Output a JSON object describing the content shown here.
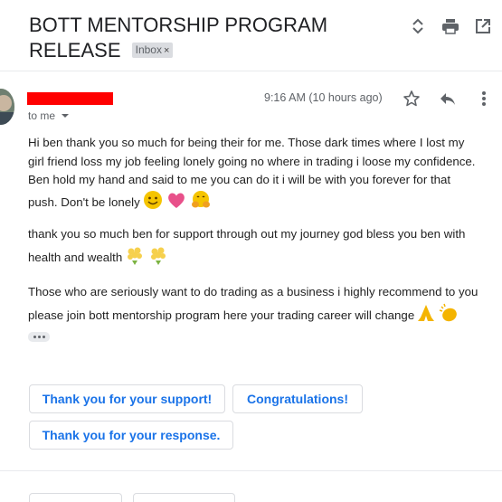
{
  "subject": {
    "line1": "BOTT MENTORSHIP PROGRAM",
    "line2": "RELEASE",
    "label": "Inbox",
    "label_close": "×"
  },
  "toolbar": {
    "icons": [
      "expand-collapse-icon",
      "print-icon",
      "open-in-new-window-icon"
    ]
  },
  "message": {
    "sender_name": "",
    "to": "to me",
    "time": "9:16 AM (10 hours ago)",
    "actions": [
      "star-icon",
      "reply-icon",
      "more-vert-icon"
    ],
    "paragraphs": [
      "Hi ben thank you so much for being their for me. Those dark times where I lost my girl friend loss my job feeling lonely going no where in trading i loose my confidence. Ben hold my hand and said to me you can do it i will be with you forever for that push. Don't be lonely",
      " thank you so much ben for  support through out my journey god bless you ben  with health and wealth",
      "Those who are seriously want to do trading as a business i highly recommend to you please join bott mentorship program here your trading career will change"
    ],
    "emojis": {
      "p1": [
        "smiling-face",
        "pink-heart",
        "hugging-face"
      ],
      "p2": [
        "bouquet",
        "bouquet"
      ],
      "p3": [
        "folded-hands",
        "clapping-hands"
      ]
    }
  },
  "smart_replies": [
    "Thank you for your support!",
    "Congratulations!",
    "Thank you for your response."
  ],
  "colors": {
    "accent": "#1a73e8",
    "redaction": "#ff0000",
    "muted": "#5f6368"
  }
}
